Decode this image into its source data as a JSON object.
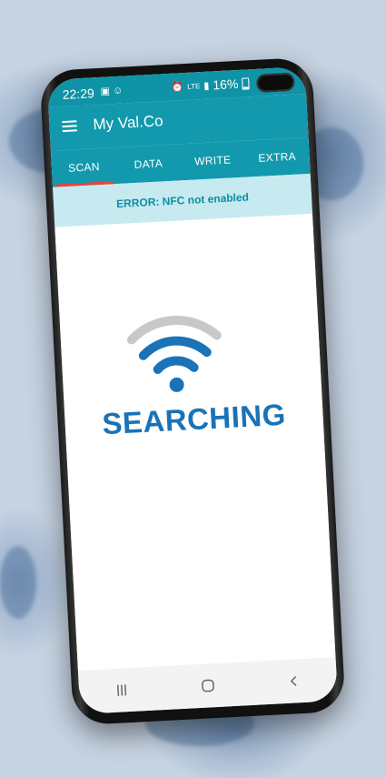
{
  "status_bar": {
    "time": "22:29",
    "network": "LTE",
    "battery": "16%",
    "notification_icons": [
      "image-icon",
      "people-icon"
    ]
  },
  "toolbar": {
    "title": "My Val.Co",
    "menu_icon": "menu-icon"
  },
  "tabs": [
    {
      "label": "SCAN",
      "active": true
    },
    {
      "label": "DATA",
      "active": false
    },
    {
      "label": "WRITE",
      "active": false
    },
    {
      "label": "EXTRA",
      "active": false
    }
  ],
  "error_banner": {
    "text": "ERROR: NFC not enabled"
  },
  "main": {
    "status_text": "SEARCHING",
    "status_icon": "wifi-searching-icon"
  },
  "nav_bar": {
    "recents_icon": "recents-icon",
    "home_icon": "home-icon",
    "back_icon": "back-icon"
  },
  "colors": {
    "header": "#1299ad",
    "banner_bg": "#c6eaf0",
    "banner_text": "#0f8ea1",
    "tab_indicator": "#e8443a",
    "searching_blue": "#1a73b8",
    "wifi_gray_arc": "#c8c8c8"
  }
}
